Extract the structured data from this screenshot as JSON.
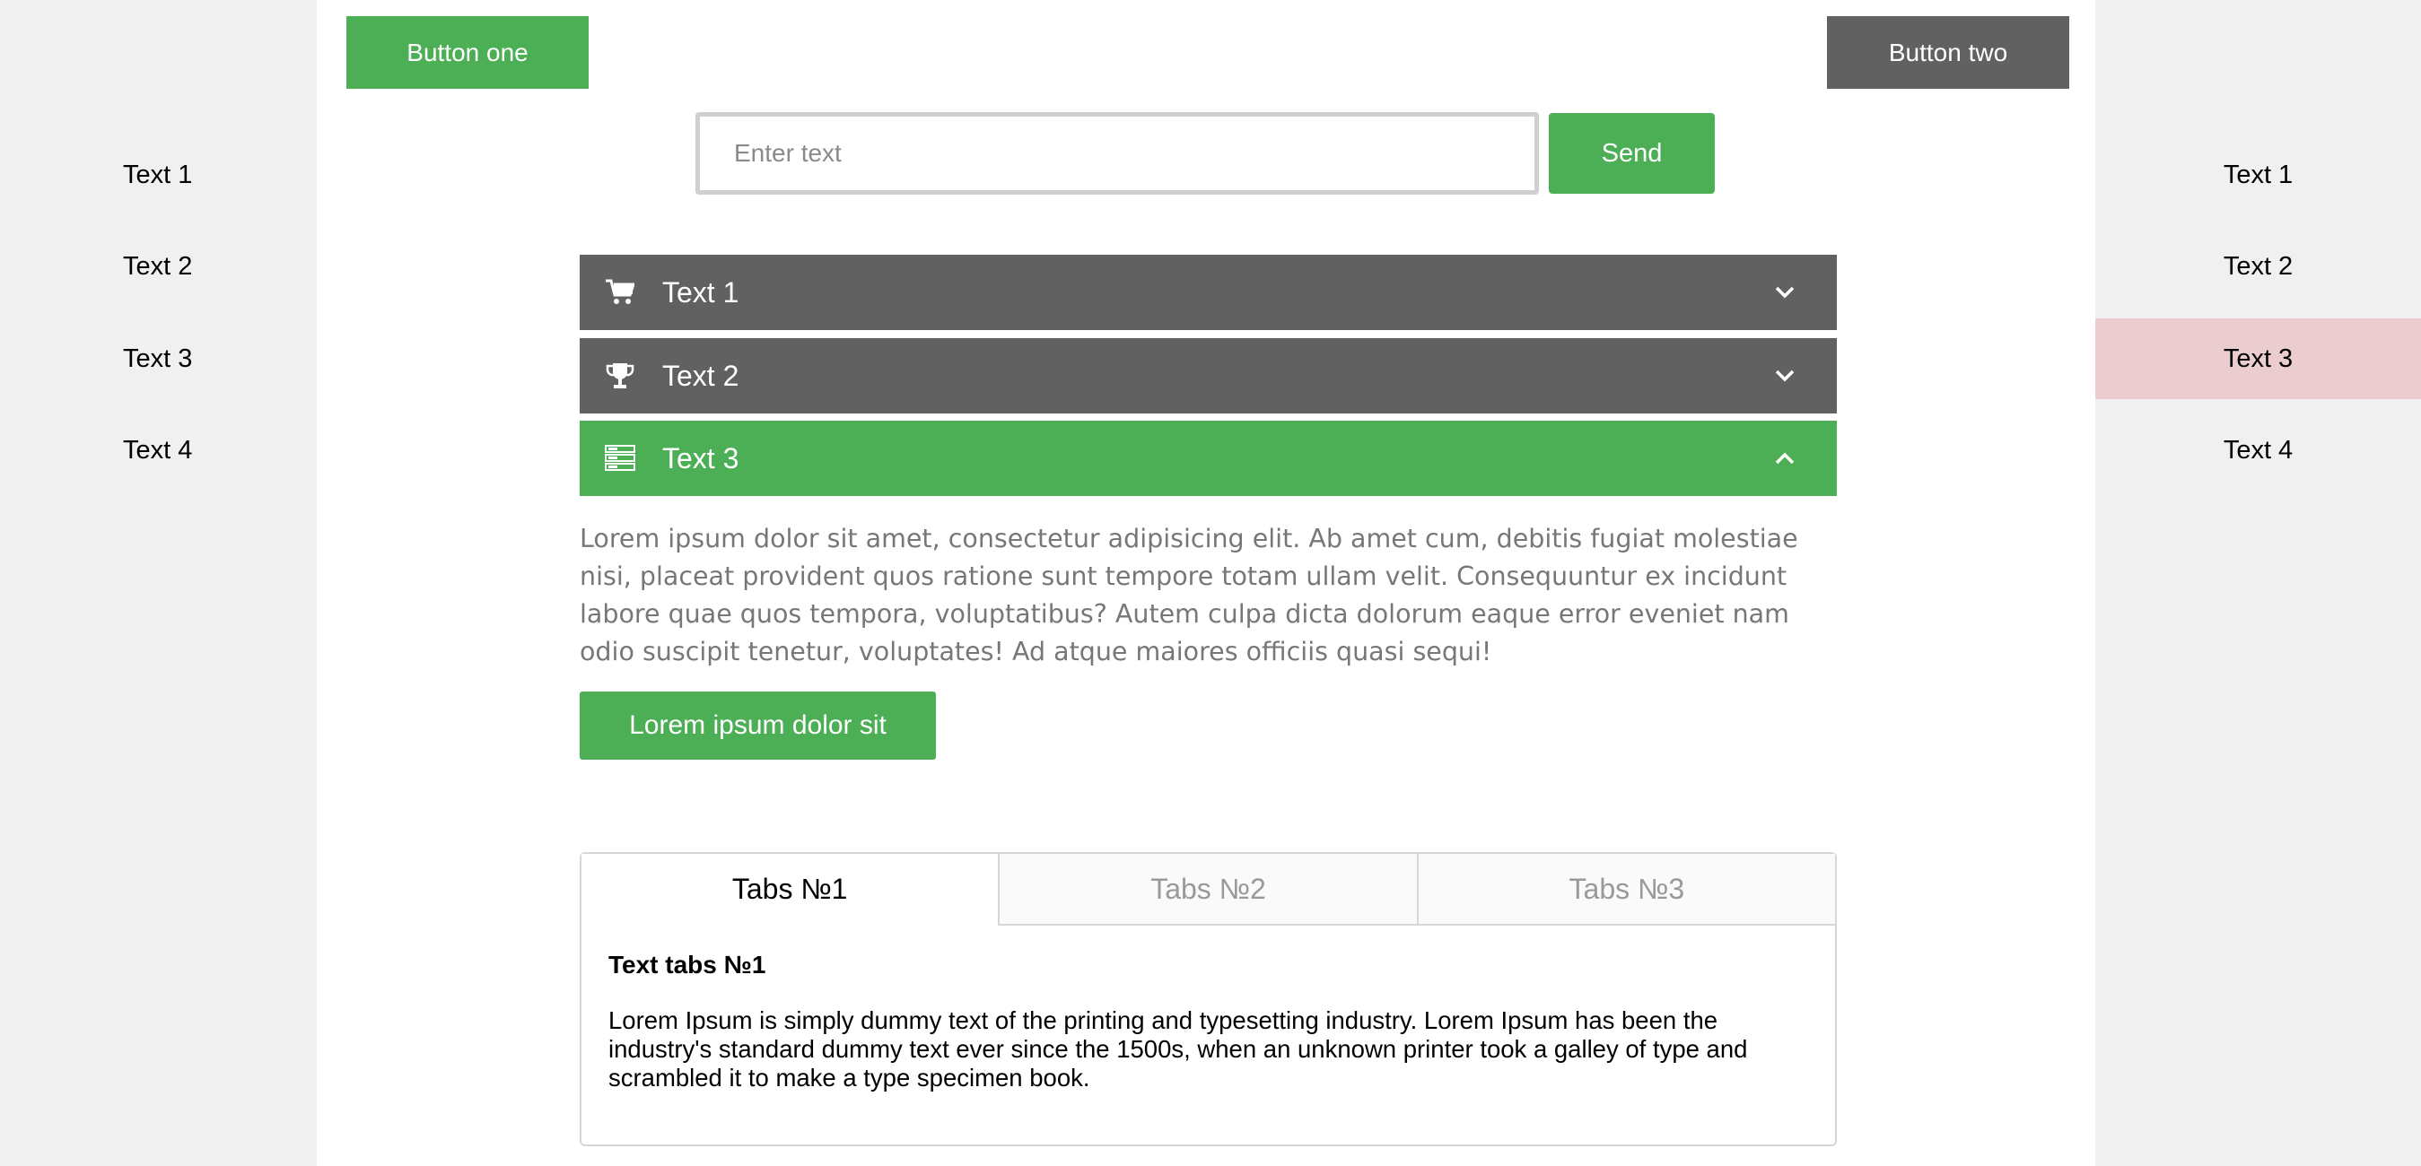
{
  "left_sidebar": {
    "items": [
      "Text 1",
      "Text 2",
      "Text 3",
      "Text 4"
    ]
  },
  "right_sidebar": {
    "items": [
      "Text 1",
      "Text 2",
      "Text 3",
      "Text 4"
    ],
    "active_index": 2
  },
  "header": {
    "button_one": "Button one",
    "button_two": "Button two"
  },
  "form": {
    "placeholder": "Enter text",
    "value": "",
    "send_label": "Send"
  },
  "accordion": {
    "items": [
      {
        "label": "Text 1",
        "icon": "cart-icon",
        "open": false
      },
      {
        "label": "Text 2",
        "icon": "trophy-icon",
        "open": false
      },
      {
        "label": "Text 3",
        "icon": "server-icon",
        "open": true
      }
    ],
    "body_text": "Lorem ipsum dolor sit amet, consectetur adipisicing elit. Ab amet cum, debitis fugiat molestiae nisi, placeat provident quos ratione sunt tempore totam ullam velit. Consequuntur ex incidunt labore quae quos tempora, voluptatibus? Autem culpa dicta dolorum eaque error eveniet nam odio suscipit tenetur, voluptates! Ad atque maiores officiis quasi sequi!",
    "body_button": "Lorem ipsum dolor sit"
  },
  "tabs": {
    "labels": [
      "Tabs №1",
      "Tabs №2",
      "Tabs №3"
    ],
    "active_index": 0,
    "heading": "Text tabs №1",
    "text": "Lorem Ipsum is simply dummy text of the printing and typesetting industry. Lorem Ipsum has been the industry's standard dummy text ever since the 1500s, when an unknown printer took a galley of type and scrambled it to make a type specimen book."
  },
  "colors": {
    "accent_green": "#4daf55",
    "dark_gray": "#616161",
    "active_side": "#ebcdd0"
  }
}
